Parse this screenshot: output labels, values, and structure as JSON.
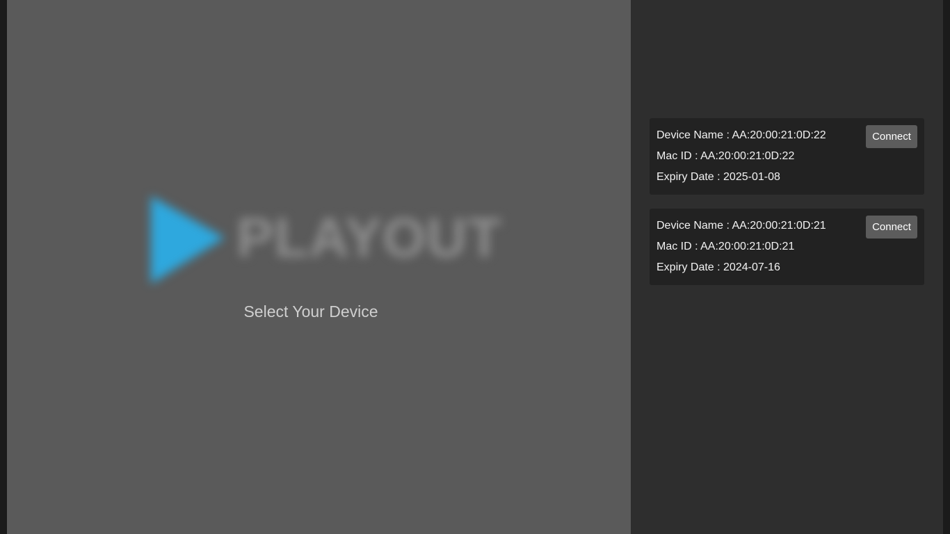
{
  "logo": {
    "wordmark": "PLAYOUT",
    "accent_color": "#2ea8de"
  },
  "page": {
    "subtitle": "Select Your Device"
  },
  "devices": [
    {
      "name_label": "Device Name : AA:20:00:21:0D:22",
      "mac_label": "Mac ID : AA:20:00:21:0D:22",
      "expiry_label": "Expiry Date : 2025-01-08",
      "connect_label": "Connect"
    },
    {
      "name_label": "Device Name : AA:20:00:21:0D:21",
      "mac_label": "Mac ID : AA:20:00:21:0D:21",
      "expiry_label": "Expiry Date : 2024-07-16",
      "connect_label": "Connect"
    }
  ]
}
